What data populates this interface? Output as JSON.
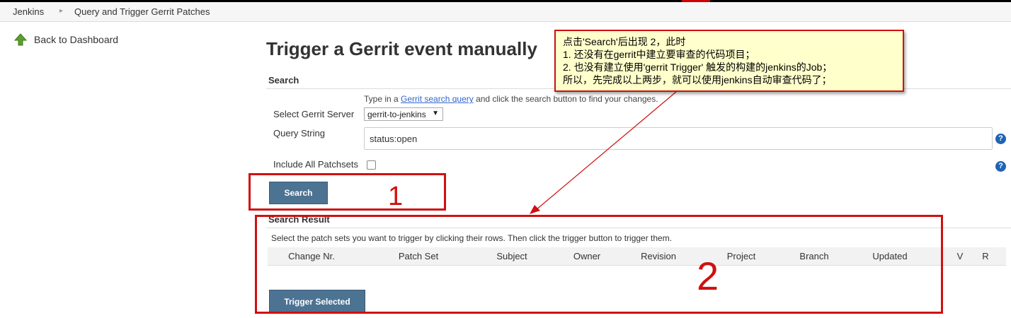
{
  "breadcrumbs": {
    "home": "Jenkins",
    "current": "Query and Trigger Gerrit Patches"
  },
  "sidebar": {
    "back_label": "Back to Dashboard"
  },
  "page": {
    "title": "Trigger a Gerrit event manually"
  },
  "search": {
    "header": "Search",
    "help_prefix": "Type in a ",
    "help_link": "Gerrit search query",
    "help_suffix": " and click the search button to find your changes.",
    "server_label": "Select Gerrit Server",
    "server_value": "gerrit-to-jenkins",
    "query_label": "Query String",
    "query_value": "status:open",
    "patchsets_label": "Include All Patchsets",
    "patchsets_checked": false,
    "button_label": "Search"
  },
  "result": {
    "header": "Search Result",
    "help": "Select the patch sets you want to trigger by clicking their rows. Then click the trigger button to trigger them.",
    "columns": [
      "Change Nr.",
      "Patch Set",
      "Subject",
      "Owner",
      "Revision",
      "Project",
      "Branch",
      "Updated",
      "V",
      "R"
    ],
    "trigger_label": "Trigger Selected"
  },
  "annotation": {
    "lines": [
      "点击'Search'后出现 2，此时",
      "1. 还没有在gerrit中建立要审查的代码项目；",
      "2. 也没有建立使用'gerrit Trigger' 触发的构建的jenkins的Job；",
      "所以，先完成以上两步，就可以使用jenkins自动审查代码了；"
    ],
    "mark_1": "1",
    "mark_2": "2"
  },
  "colors": {
    "button": "#4d7393",
    "annotation_red": "#d01010",
    "annotation_bg": "#ffffcc",
    "help_icon": "#1e64b4",
    "back_arrow": "#5aa02c"
  }
}
